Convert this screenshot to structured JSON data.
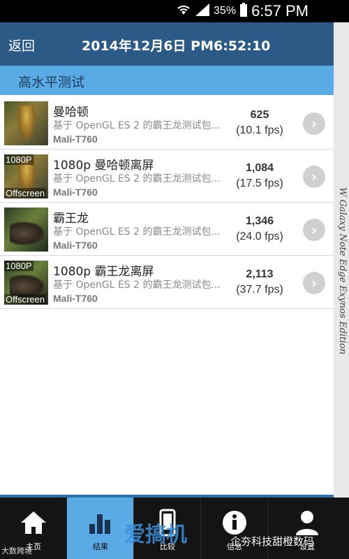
{
  "status_bar": {
    "battery_pct": "35%",
    "time": "6:57 PM"
  },
  "header": {
    "back_label": "返回",
    "title": "2014年12月6日 PM6:52:10"
  },
  "section": {
    "title": "高水平测试"
  },
  "rows": [
    {
      "name": "曼哈顿",
      "desc": "基于 OpenGL ES 2 的霸王龙测试包...",
      "gpu": "Mali-T760",
      "score": "625",
      "fps": "(10.1 fps)",
      "thumb_top": "",
      "thumb_bottom": ""
    },
    {
      "name": "1080p 曼哈顿离屏",
      "desc": "基于 OpenGL ES 2 的霸王龙测试包...",
      "gpu": "Mali-T760",
      "score": "1,084",
      "fps": "(17.5 fps)",
      "thumb_top": "1080P",
      "thumb_bottom": "Offscreen"
    },
    {
      "name": "霸王龙",
      "desc": "基于 OpenGL ES 2 的霸王龙测试包...",
      "gpu": "Mali-T760",
      "score": "1,346",
      "fps": "(24.0 fps)",
      "thumb_top": "",
      "thumb_bottom": ""
    },
    {
      "name": "1080p 霸王龙离屏",
      "desc": "基于 OpenGL ES 2 的霸王龙测试包...",
      "gpu": "Mali-T760",
      "score": "2,113",
      "fps": "(37.7 fps)",
      "thumb_top": "1080P",
      "thumb_bottom": "Offscreen"
    }
  ],
  "side_text": "W Galaxy Note Edge Exynos Edition",
  "tabs": [
    {
      "label": "主页",
      "icon": "home-icon"
    },
    {
      "label": "结果",
      "icon": "bar-chart-icon"
    },
    {
      "label": "比较",
      "icon": "phone-icon"
    },
    {
      "label": "信息",
      "icon": "info-icon"
    },
    {
      "label": "设置",
      "icon": "user-icon"
    }
  ],
  "watermarks": {
    "left": "大数跨境",
    "logo": "爱搞机",
    "right": "企夯科技甜橙数码"
  },
  "colors": {
    "title_bar": "#2c5a86",
    "section_bar": "#5aaae6",
    "tab_active": "#5aaae6"
  }
}
